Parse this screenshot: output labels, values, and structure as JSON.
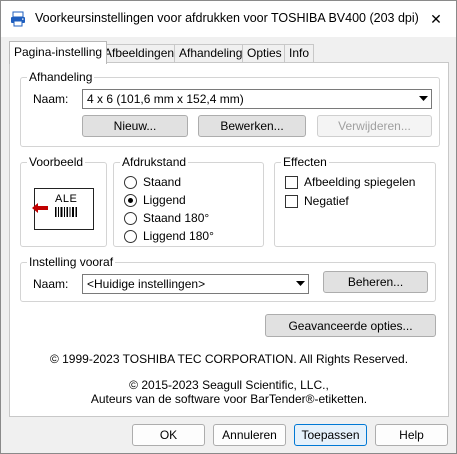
{
  "window": {
    "title": "Voorkeursinstellingen voor afdrukken voor TOSHIBA BV400 (203 dpi)",
    "close_glyph": "✕"
  },
  "tabs": [
    {
      "label": "Pagina-instelling",
      "active": true
    },
    {
      "label": "Afbeeldingen",
      "active": false
    },
    {
      "label": "Afhandeling",
      "active": false
    },
    {
      "label": "Opties",
      "active": false
    },
    {
      "label": "Info",
      "active": false
    }
  ],
  "afhandeling": {
    "group_label": "Afhandeling",
    "name_label": "Naam:",
    "name_value": "4 x 6 (101,6 mm x 152,4 mm)",
    "new_button": "Nieuw...",
    "edit_button": "Bewerken...",
    "delete_button": "Verwijderen..."
  },
  "preview": {
    "group_label": "Voorbeeld",
    "sample_text": "ALE"
  },
  "orientation": {
    "group_label": "Afdrukstand",
    "options": [
      {
        "label": "Staand",
        "selected": false
      },
      {
        "label": "Liggend",
        "selected": true
      },
      {
        "label": "Staand 180°",
        "selected": false
      },
      {
        "label": "Liggend 180°",
        "selected": false
      }
    ]
  },
  "effects": {
    "group_label": "Effecten",
    "options": [
      {
        "label": "Afbeelding spiegelen",
        "checked": false
      },
      {
        "label": "Negatief",
        "checked": false
      }
    ]
  },
  "preset": {
    "group_label": "Instelling vooraf",
    "name_label": "Naam:",
    "name_value": "<Huidige instellingen>",
    "manage_button": "Beheren..."
  },
  "advanced_button": "Geavanceerde opties...",
  "copyright": {
    "line1": "© 1999-2023 TOSHIBA TEC CORPORATION.  All Rights Reserved.",
    "line2": "© 2015-2023 Seagull Scientific, LLC.,",
    "line3": "Auteurs van de software voor BarTender®-etiketten."
  },
  "footer": {
    "ok": "OK",
    "cancel": "Annuleren",
    "apply": "Toepassen",
    "help": "Help"
  },
  "colors": {
    "accent": "#0078d4",
    "preview_arrow": "#c00000",
    "app_icon": "#1f5fbf"
  }
}
